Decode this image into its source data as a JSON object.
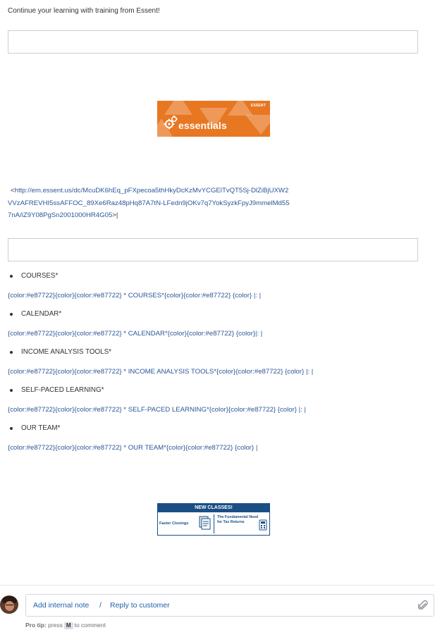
{
  "intro_text": "Continue your learning with training from Essent!",
  "banner_essentials": {
    "brand": "ESSENT",
    "word": "essentials",
    "color": "#e87722"
  },
  "url_block": {
    "prefix": "<",
    "url": "http://em.essent.us/dc/McuDK6hEq_pFXpecoa5thHkyDcKzMvYCGElTvQT5Sj-DlZiBjUXW2VVzAFREVHI5ssAFFOC_89Xe6Raz48pHq87A7tN-LFedn9jOKv7q7YokSyzkFpyJ9mmelMd557nA/iZ9Y08PgSn2001000HR4G05",
    "suffix": ">|"
  },
  "menu": [
    {
      "label": "COURSES*",
      "code": "{color:#e87722}{color}{color:#e87722} * COURSES*{color}{color:#e87722} {color} |: |"
    },
    {
      "label": "CALENDAR*",
      "code": "{color:#e87722}{color}{color:#e87722} * CALENDAR*{color}{color:#e87722} {color}|: |"
    },
    {
      "label": "INCOME ANALYSIS TOOLS*",
      "code": "{color:#e87722}{color}{color:#e87722} * INCOME ANALYSIS TOOLS*{color}{color:#e87722} {color} |: |"
    },
    {
      "label": "SELF-PACED LEARNING*",
      "code": "{color:#e87722}{color}{color:#e87722} * SELF-PACED LEARNING*{color}{color:#e87722} {color} |: |"
    },
    {
      "label": "OUR TEAM*",
      "code": "{color:#e87722}{color}{color:#e87722} * OUR TEAM*{color}{color:#e87722} {color} |"
    }
  ],
  "banner_new_classes": {
    "heading": "NEW CLASSES!",
    "left_title": "Faster Closings",
    "right_title": "The Fundamental Need for Tax Returns",
    "color": "#1a4f86"
  },
  "composer": {
    "add_note": "Add internal note",
    "separator": "/",
    "reply": "Reply to customer",
    "icon": "paperclip-icon"
  },
  "protip": {
    "label": "Pro tip:",
    "before_key": "press",
    "key": "M",
    "after_key": "to comment"
  }
}
